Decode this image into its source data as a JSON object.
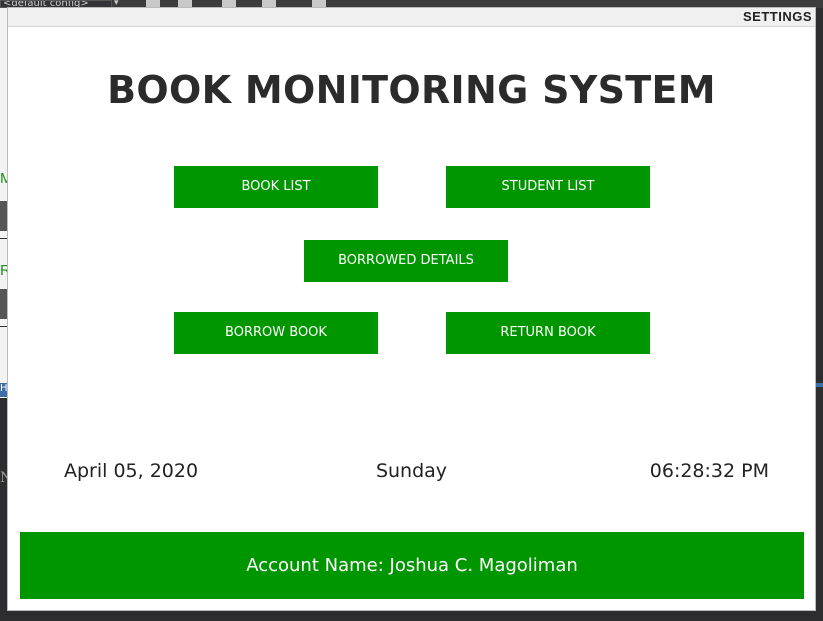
{
  "ide": {
    "config_combo": "<default config>",
    "left_letters": [
      "M",
      "R"
    ],
    "left_blue_letter": "H",
    "left_lower_letter": "N"
  },
  "window": {
    "settings_label": "SETTINGS",
    "title": "BOOK MONITORING SYSTEM"
  },
  "buttons": {
    "book_list": "BOOK LIST",
    "student_list": "STUDENT LIST",
    "borrowed_details": "BORROWED DETAILS",
    "borrow_book": "BORROW BOOK",
    "return_book": "RETURN BOOK"
  },
  "status": {
    "date": "April 05, 2020",
    "day": "Sunday",
    "time": "06:28:32 PM"
  },
  "footer": {
    "account_name": "Account Name: Joshua C. Magoliman"
  },
  "colors": {
    "button_green": "#009600",
    "title_text": "#2b2b2b"
  }
}
